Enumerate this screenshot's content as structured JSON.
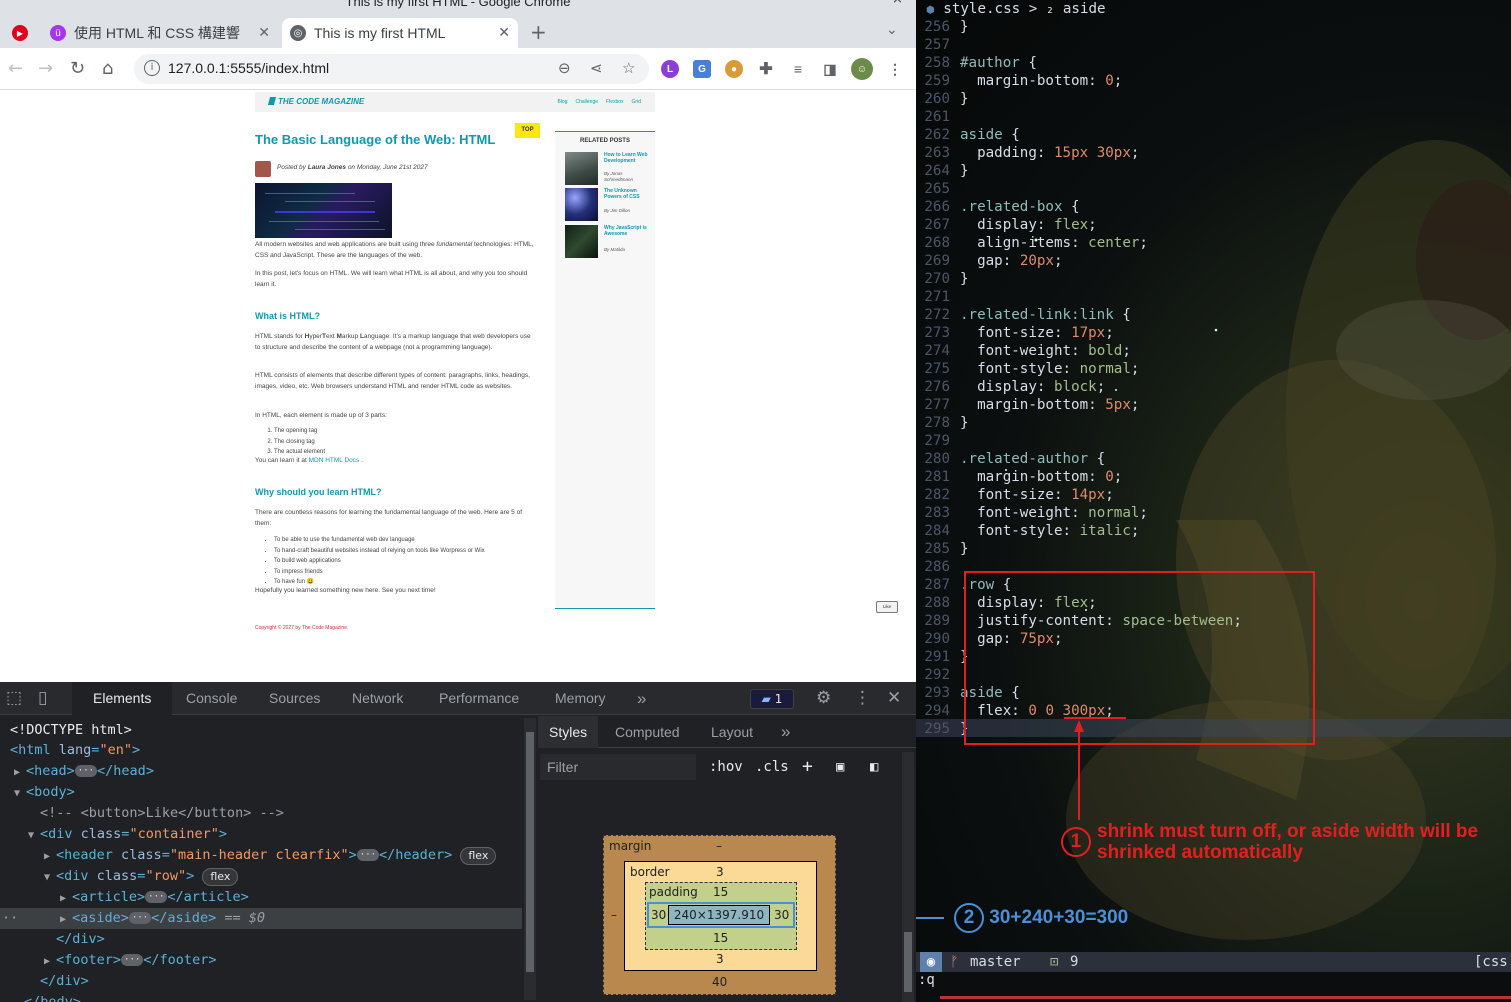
{
  "window": {
    "title": "This is my first HTML - Google Chrome"
  },
  "tabs": [
    {
      "label": "使用 HTML 和 CSS 構建響",
      "favicon": "teal-course-icon"
    },
    {
      "label": "This is my first HTML",
      "favicon": "globe-icon"
    }
  ],
  "toolbar": {
    "url": "127.0.0.1:5555/index.html"
  },
  "site": {
    "logo": "THE CODE MAGAZINE",
    "nav": [
      "Blog",
      "Challenge",
      "Flexbox",
      "Grid"
    ],
    "top_badge": "TOP",
    "title": "The Basic Language of the Web: HTML",
    "posted_by": "Posted by ",
    "author": "Laura Jones",
    "posted_on": " on Monday, June 21st 2027",
    "p1_a": "All modern websites and web applications are built using three ",
    "p1_em": "fundamental",
    "p1_b": " technologies: HTML, CSS and JavaScript. These are the languages of the web.",
    "p2": "In this post, let's focus on HTML. We will learn what HTML is all about, and why you too should learn it.",
    "h_what": "What is HTML?",
    "p3_a": "HTML stands for ",
    "p3_h": "H",
    "p3_b": "yper",
    "p3_t": "T",
    "p3_c": "ext ",
    "p3_m": "M",
    "p3_d": "arkup ",
    "p3_l": "L",
    "p3_e": "anguage. It's a markup language that web developers use to structure and describe the content of a webpage (not a programming language).",
    "p4": "HTML consists of elements that describe different types of content: paragraphs, links, headings, images, video, etc. Web browsers understand HTML and render HTML code as websites.",
    "p5": "In HTML, each element is made up of 3 parts:",
    "parts": [
      "The opening tag",
      "The closing tag",
      "The actual element"
    ],
    "learn_a": "You can learn it at ",
    "learn_link": "MDN HTML Docs",
    "learn_b": ".",
    "h_why": "Why should you learn HTML?",
    "p6": "There are countless reasons for learning the fundamental language of the web. Here are 5 of them:",
    "reasons": [
      "To be able to use the fundamental web dev language",
      "To hand-craft beautiful websites instead of relying on tools like Worpress or Wix",
      "To build web applications",
      "To impress friends",
      "To have fun 😃"
    ],
    "p7": "Hopefully you learned something new here. See you next time!",
    "aside_title": "RELATED POSTS",
    "related": [
      {
        "title": "How to Learn Web Development",
        "author": "By Jonas Schmedtmann"
      },
      {
        "title": "The Unknown Powers of CSS",
        "author": "By Jim Dillon"
      },
      {
        "title": "Why JavaScript is Awesome",
        "author": "By Matilda"
      }
    ],
    "like": "Like",
    "copyright": "Copyright © 2027 by The Code Magazine."
  },
  "devtools": {
    "tabs": [
      "Elements",
      "Console",
      "Sources",
      "Network",
      "Performance",
      "Memory"
    ],
    "more": "»",
    "issues_count": "1",
    "dom": {
      "doctype": "<!DOCTYPE html>",
      "html_open": "<html",
      "html_attr": "lang",
      "html_val": "\"en\"",
      "head": "<head>",
      "head_close": "</head>",
      "body": "<body>",
      "comment": "<!-- <button>Like</button> -->",
      "container_tag": "<div",
      "container_attr": "class",
      "container_val": "\"container\"",
      "header_tag": "<header",
      "header_val": "\"main-header clearfix\"",
      "header_close": "</header>",
      "row_val": "\"row\"",
      "article": "<article>",
      "article_close": "</article>",
      "aside": "<aside>",
      "aside_close": "</aside>",
      "eq": "== $0",
      "div_close": "</div>",
      "footer": "<footer>",
      "footer_close": "</footer>",
      "body_close": "</body>",
      "flex": "flex",
      "gt": ">",
      "ellipsis": "···"
    },
    "styles_tabs": [
      "Styles",
      "Computed",
      "Layout"
    ],
    "filter_placeholder": "Filter",
    "hov": ":hov",
    "cls": ".cls",
    "box": {
      "margin_label": "margin",
      "margin_top": "–",
      "margin_left": "–",
      "margin_bottom": "40",
      "border_label": "border",
      "border_top": "3",
      "border_bottom": "3",
      "padding_label": "padding",
      "padding_top": "15",
      "padding_left": "30",
      "padding_right": "30",
      "padding_bottom": "15",
      "content": "240×1397.910"
    }
  },
  "editor": {
    "tab_title": "style.css > ₂ aside",
    "lines": [
      {
        "n": "256",
        "t": "}"
      },
      {
        "n": "257",
        "t": ""
      },
      {
        "n": "258",
        "t": "#author {"
      },
      {
        "n": "259",
        "t": "  margin-bottom: 0;"
      },
      {
        "n": "260",
        "t": "}"
      },
      {
        "n": "261",
        "t": ""
      },
      {
        "n": "262",
        "t": "aside {"
      },
      {
        "n": "263",
        "t": "  padding: 15px 30px;"
      },
      {
        "n": "264",
        "t": "}"
      },
      {
        "n": "265",
        "t": ""
      },
      {
        "n": "266",
        "t": ".related-box {"
      },
      {
        "n": "267",
        "t": "  display: flex;"
      },
      {
        "n": "268",
        "t": "  align-items: center;"
      },
      {
        "n": "269",
        "t": "  gap: 20px;"
      },
      {
        "n": "270",
        "t": "}"
      },
      {
        "n": "271",
        "t": ""
      },
      {
        "n": "272",
        "t": ".related-link:link {"
      },
      {
        "n": "273",
        "t": "  font-size: 17px;"
      },
      {
        "n": "274",
        "t": "  font-weight: bold;"
      },
      {
        "n": "275",
        "t": "  font-style: normal;"
      },
      {
        "n": "276",
        "t": "  display: block;"
      },
      {
        "n": "277",
        "t": "  margin-bottom: 5px;"
      },
      {
        "n": "278",
        "t": "}"
      },
      {
        "n": "279",
        "t": ""
      },
      {
        "n": "280",
        "t": ".related-author {"
      },
      {
        "n": "281",
        "t": "  margin-bottom: 0;"
      },
      {
        "n": "282",
        "t": "  font-size: 14px;"
      },
      {
        "n": "283",
        "t": "  font-weight: normal;"
      },
      {
        "n": "284",
        "t": "  font-style: italic;"
      },
      {
        "n": "285",
        "t": "}"
      },
      {
        "n": "286",
        "t": ""
      },
      {
        "n": "287",
        "t": ".row {"
      },
      {
        "n": "288",
        "t": "  display: flex;"
      },
      {
        "n": "289",
        "t": "  justify-content: space-between;"
      },
      {
        "n": "290",
        "t": "  gap: 75px;"
      },
      {
        "n": "291",
        "t": "}"
      },
      {
        "n": "292",
        "t": ""
      },
      {
        "n": "293",
        "t": "aside {"
      },
      {
        "n": "294",
        "t": "  flex: 0 0 300px;"
      },
      {
        "n": "295",
        "t": "}"
      }
    ],
    "annotation1_num": "1",
    "annotation1_text": "shrink must turn off, or aside width will be shrinked automatically",
    "annotation2_num": "2",
    "annotation2_text": "30+240+30=300",
    "status_branch": "master",
    "status_count": "9",
    "status_ft": "[css",
    "cmd": ":q",
    "colors": {
      "annotation_red": "#e02020",
      "annotation_blue": "#4a90d9"
    }
  }
}
